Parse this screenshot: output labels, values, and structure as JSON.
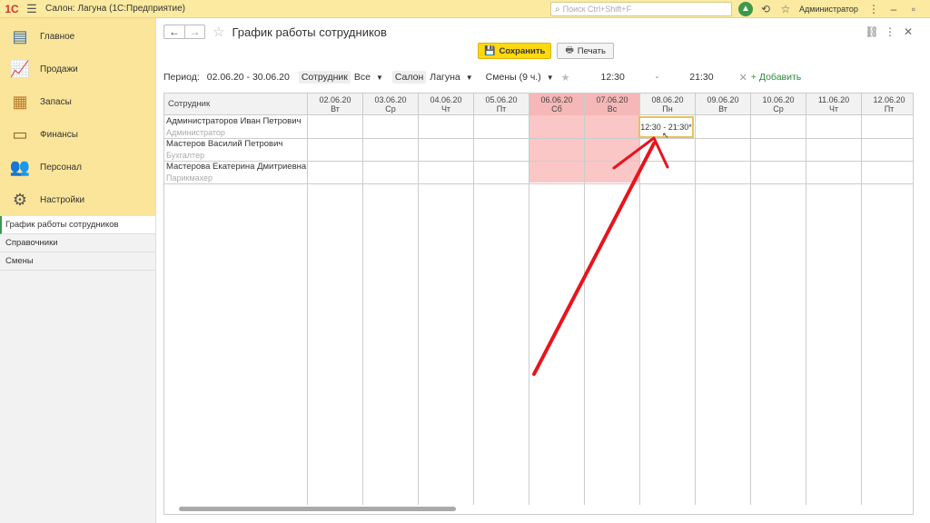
{
  "app": {
    "logo": "1С",
    "title": "Салон: Лагуна  (1С:Предприятие)",
    "search_placeholder": "Поиск Ctrl+Shift+F",
    "user": "Администратор"
  },
  "sidebar": {
    "sections": [
      {
        "label": "Главное",
        "icon": "list-icon"
      },
      {
        "label": "Продажи",
        "icon": "chart-icon"
      },
      {
        "label": "Запасы",
        "icon": "boxes-icon"
      },
      {
        "label": "Финансы",
        "icon": "wallet-icon"
      },
      {
        "label": "Персонал",
        "icon": "people-icon"
      },
      {
        "label": "Настройки",
        "icon": "gear-icon"
      }
    ],
    "nav": [
      "График работы сотрудников",
      "Справочники",
      "Смены"
    ]
  },
  "page": {
    "title": "График работы сотрудников",
    "save_label": "Сохранить",
    "print_label": "Печать"
  },
  "filters": {
    "period_label": "Период:",
    "period_value": "02.06.20 - 30.06.20",
    "employee_label": "Сотрудник",
    "employee_value": "Все",
    "salon_label": "Салон",
    "salon_value": "Лагуна",
    "shifts_value": "Смены (9 ч.)",
    "time_from": "12:30",
    "time_sep": "-",
    "time_to": "21:30",
    "add_label": "+ Добавить"
  },
  "grid": {
    "employee_header": "Сотрудник",
    "days": [
      {
        "date": "02.06.20",
        "dow": "Вт",
        "weekend": false
      },
      {
        "date": "03.06.20",
        "dow": "Ср",
        "weekend": false
      },
      {
        "date": "04.06.20",
        "dow": "Чт",
        "weekend": false
      },
      {
        "date": "05.06.20",
        "dow": "Пт",
        "weekend": false
      },
      {
        "date": "06.06.20",
        "dow": "Сб",
        "weekend": true
      },
      {
        "date": "07.06.20",
        "dow": "Вс",
        "weekend": true
      },
      {
        "date": "08.06.20",
        "dow": "Пн",
        "weekend": false
      },
      {
        "date": "09.06.20",
        "dow": "Вт",
        "weekend": false
      },
      {
        "date": "10.06.20",
        "dow": "Ср",
        "weekend": false
      },
      {
        "date": "11.06.20",
        "dow": "Чт",
        "weekend": false
      },
      {
        "date": "12.06.20",
        "dow": "Пт",
        "weekend": false
      }
    ],
    "employees": [
      {
        "name": "Администраторов Иван Петрович",
        "role": "Администратор"
      },
      {
        "name": "Мастеров Василий Петрович",
        "role": "Бухгалтер"
      },
      {
        "name": "Мастерова Екатерина Дмитриевна",
        "role": "Парикмахер"
      }
    ],
    "shift_text": "12:30 - 21:30*"
  },
  "colors": {
    "accent": "#ffd90f",
    "sidebar_bg": "#fbe59a",
    "weekend": "#fbc6c6",
    "annotation": "#e8141c"
  }
}
